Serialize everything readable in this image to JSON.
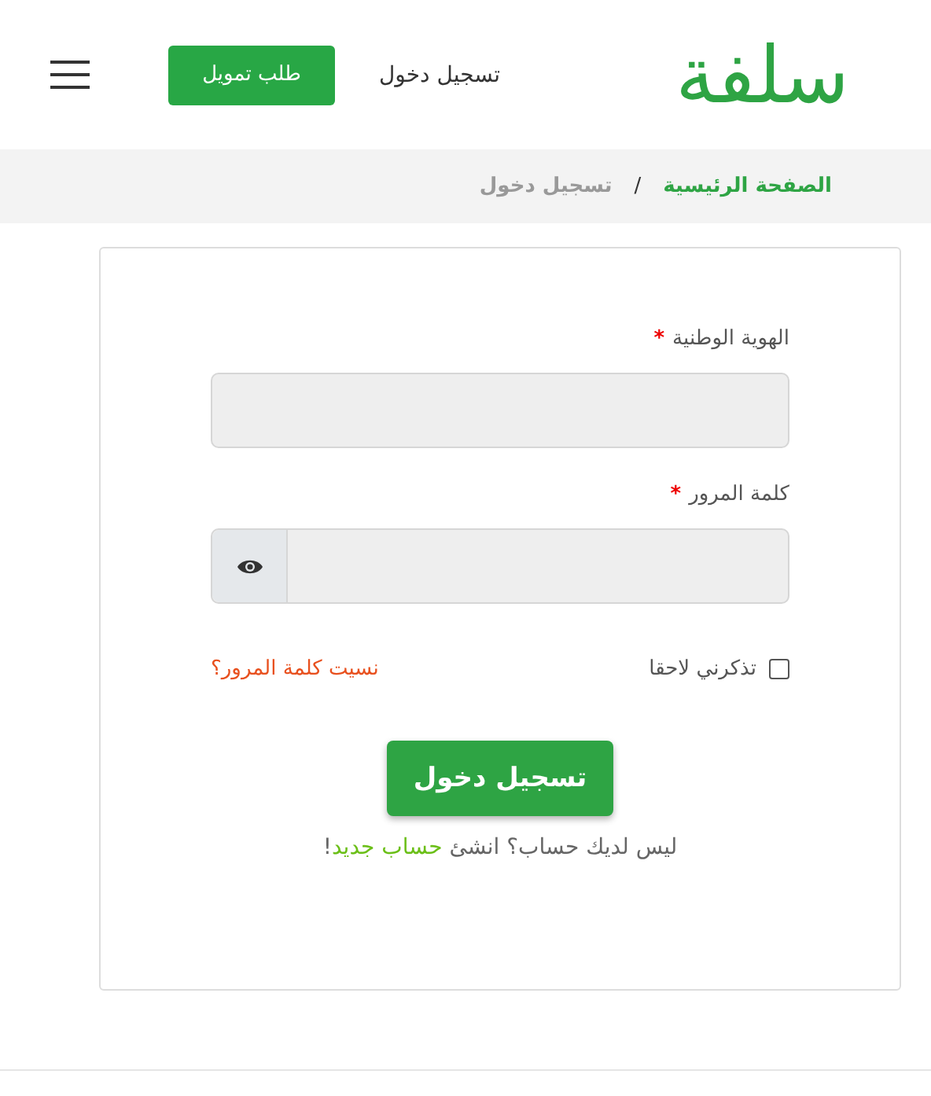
{
  "header": {
    "logo": "سلفة",
    "login_link": "تسجيل دخول",
    "finance_button": "طلب تمويل"
  },
  "breadcrumb": [
    {
      "label": "الصفحة الرئيسية",
      "selected": false
    },
    {
      "label": "/",
      "kind": "separator"
    },
    {
      "label": "تسجيل دخول",
      "selected": true
    }
  ],
  "form": {
    "fields": [
      {
        "label": "الهوية الوطنية",
        "required_mark": "*",
        "kind": "text"
      },
      {
        "label": "كلمة المرور",
        "required_mark": "*",
        "kind": "password"
      }
    ],
    "remember": {
      "label": "تذكرني لاحقا",
      "checked": false
    },
    "forgot_link": "نسيت كلمة المرور؟",
    "submit": "تسجيل دخول",
    "signup": {
      "text": "ليس لديك حساب؟ انشئ",
      "link": "حساب جديد",
      "end": "!"
    }
  }
}
